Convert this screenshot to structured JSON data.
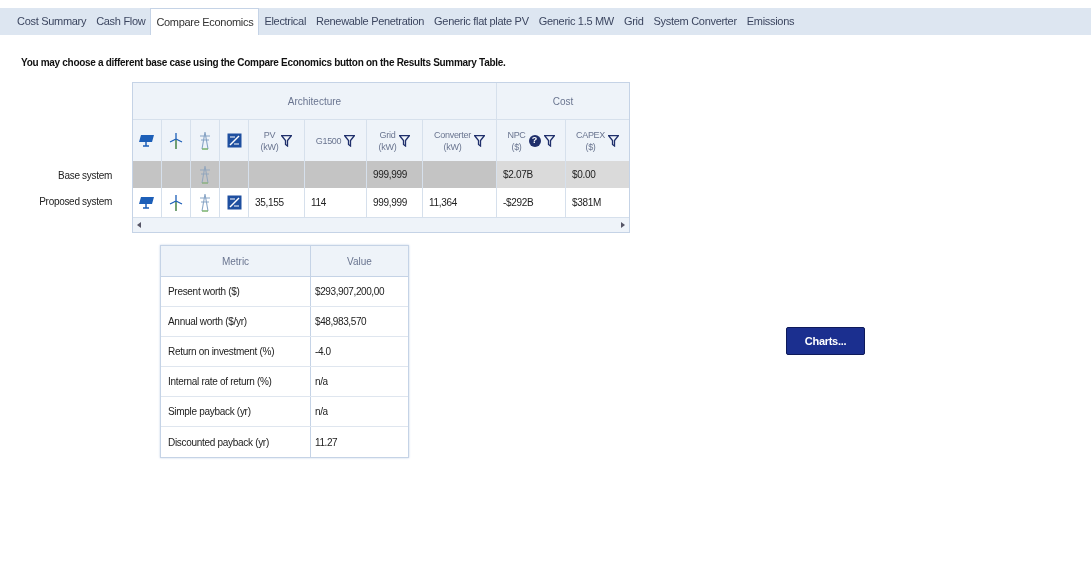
{
  "tabs": [
    {
      "label": "Cost Summary",
      "selected": false
    },
    {
      "label": "Cash Flow",
      "selected": false
    },
    {
      "label": "Compare Economics",
      "selected": true
    },
    {
      "label": "Electrical",
      "selected": false
    },
    {
      "label": "Renewable Penetration",
      "selected": false
    },
    {
      "label": "Generic flat plate PV",
      "selected": false
    },
    {
      "label": "Generic 1.5 MW",
      "selected": false
    },
    {
      "label": "Grid",
      "selected": false
    },
    {
      "label": "System Converter",
      "selected": false
    },
    {
      "label": "Emissions",
      "selected": false
    }
  ],
  "note": "You may choose a different base case using the Compare Economics button on the Results Summary Table.",
  "comparison_table": {
    "groups": [
      {
        "label": "Architecture"
      },
      {
        "label": "Cost"
      }
    ],
    "columns": [
      {
        "kind": "icon"
      },
      {
        "kind": "icon"
      },
      {
        "kind": "icon"
      },
      {
        "kind": "icon"
      },
      {
        "kind": "text",
        "label": "PV",
        "unit": "(kW)",
        "filter": true
      },
      {
        "kind": "text",
        "label": "G1500",
        "filter": true
      },
      {
        "kind": "text",
        "label": "Grid",
        "unit": "(kW)",
        "filter": true
      },
      {
        "kind": "text",
        "label": "Converter",
        "unit": "(kW)",
        "filter": true
      },
      {
        "kind": "text",
        "label": "NPC",
        "unit": "($)",
        "help": "?",
        "filter": true
      },
      {
        "kind": "text",
        "label": "CAPEX",
        "unit": "($)",
        "filter": true
      }
    ],
    "rows": [
      {
        "label": "Base system",
        "highlighted": true,
        "cells": [
          {
            "kind": "icon",
            "shown": false
          },
          {
            "kind": "icon",
            "shown": false
          },
          {
            "kind": "icon",
            "shown": true
          },
          {
            "kind": "icon",
            "shown": false
          },
          {
            "kind": "text"
          },
          {
            "kind": "text"
          },
          {
            "kind": "text",
            "text": "999,999"
          },
          {
            "kind": "text"
          },
          {
            "kind": "text",
            "text": "$2.07B"
          },
          {
            "kind": "text",
            "text": "$0.00"
          }
        ]
      },
      {
        "label": "Proposed system",
        "highlighted": false,
        "cells": [
          {
            "kind": "icon",
            "shown": true
          },
          {
            "kind": "icon",
            "shown": true
          },
          {
            "kind": "icon",
            "shown": true
          },
          {
            "kind": "icon",
            "shown": true
          },
          {
            "kind": "text",
            "text": "35,155"
          },
          {
            "kind": "text",
            "text": "114"
          },
          {
            "kind": "text",
            "text": "999,999"
          },
          {
            "kind": "text",
            "text": "11,364"
          },
          {
            "kind": "text",
            "text": "-$292B"
          },
          {
            "kind": "text",
            "text": "$381M"
          }
        ]
      }
    ]
  },
  "metrics_table": {
    "columns": [
      "Metric",
      "Value"
    ],
    "rows": [
      {
        "metric": "Present worth ($)",
        "value": "$293,907,200,00"
      },
      {
        "metric": "Annual worth ($/yr)",
        "value": "$48,983,570"
      },
      {
        "metric": "Return on investment (%)",
        "value": "-4.0"
      },
      {
        "metric": "Internal rate of return (%)",
        "value": "n/a"
      },
      {
        "metric": "Simple payback (yr)",
        "value": "n/a"
      },
      {
        "metric": "Discounted payback (yr)",
        "value": "11.27"
      }
    ]
  },
  "charts_button": "Charts..."
}
